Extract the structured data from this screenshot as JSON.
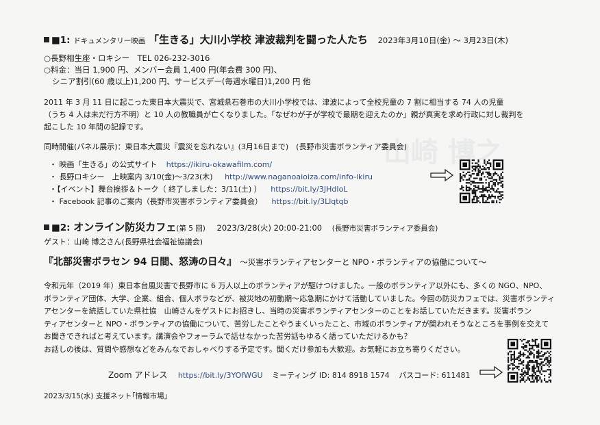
{
  "section1": {
    "heading_prefix": "■1:",
    "heading_genre": "ドキュメンタリー映画",
    "heading_title": "「生きる」大川小学校 津波裁判を闘った人たち",
    "heading_dates": "2023年3月10日(金) ～ 3月23日(木)",
    "venue": "○長野相生座・ロキシー　TEL 026-232-3016",
    "fee_line1": "○料金：当日 1,900 円、メンバー会員 1,400 円(年会費 300 円)、",
    "fee_line2": "シニア割引(60 歳以上)1,200 円、サービスデー(毎週水曜日)1,200 円 他",
    "body": [
      "2011 年 3 月 11 日に起こった東日本大震災で、宮城県石巻市の大川小学校では、津波によって全校児童の 7 割に相当する 74 人の児童",
      "（うち 4 人は未だ行方不明）と 10 人の教職員が亡くなりました。「なぜわが子が学校で最期を迎えたのか」親が真実を求め行政に対し裁判を",
      "起こした 10 年間の記録です。"
    ],
    "concurrent": "同時開催(パネル展示)：東日本大震災『震災を忘れない』(3月16日まで)　(長野市災害ボランティア委員会)",
    "links": [
      {
        "label": "・ 映画「生きる」の公式サイト",
        "url": "https://ikiru-okawafilm.com/"
      },
      {
        "label": "・ 長野ロキシー　上映案内 3/10(金)～3/23(木)",
        "url": "http://www.naganoaioiza.com/info-ikiru"
      },
      {
        "label": "・【イベント】舞台挨拶＆トーク（ 終了しました：3/11(土) ）",
        "url": "https://bit.ly/3JHdIoL"
      },
      {
        "label": "・ Facebook 記事のご案内（長野市災害ボランティア委員会）",
        "url": "https://bit.ly/3Llqtqb"
      }
    ]
  },
  "section2": {
    "heading_prefix": "■2:",
    "heading_title": "オンライン防災カフェ",
    "heading_count": "(第 5 回)",
    "heading_datetime": "2023/3/28(火) 20:00-21:00",
    "heading_org": "(長野市災害ボランティア委員会)",
    "guest": "ゲスト：山崎 博之さん(長野県社会福祉協議会)",
    "talk_title": "『北部災害ボラセン 94 日間、怒涛の日々』",
    "talk_subtitle": "～災害ボランティアセンターと NPO・ボランティアの協働について～",
    "body": [
      "令和元年（2019 年）東日本台風災害で長野市に 6 万人以上のボランティアが駆けつけました。一般のボランティア以外にも、多くの NGO、NPO、",
      "ボランティア団体、大学、企業、組合、個人ボラなどが、被災地の初動期～応急期にかけて活動していました。今回の防災カフェでは、災害ボランティ",
      "アセンターを統括していた県社協　山崎さんをゲストにお招きし、当時の災害ボランティアセンターのことをお話していただきます。災害ボラン",
      "ティアセンターと NPO・ボランティアの協働について、苦労したことやうまくいったこと、市域のボランティアが関われそうなところを事例を交えて",
      "お聞きできればと考えています。講演会やフォーラムで話せなかった苦労話もゆるく語っていただけるかも？",
      "お話しの後は、質問や感想などをみんなでおしゃべりする予定です。聞くだけ参加も大歓迎。お気軽にお立ち寄りください。"
    ],
    "zoom_label": "Zoom アドレス",
    "zoom_url": "https://bit.ly/3YOfWGU",
    "meeting_id": "ミーティング ID: 814 8918 1574",
    "passcode": "パスコード: 611481"
  },
  "footer": {
    "note": "2023/3/15(水) 支援ネット｢情報市場｣"
  },
  "colors": {
    "text": "#1a1a1a",
    "url": "#2f4a86",
    "paper": "#f6f6f4"
  }
}
